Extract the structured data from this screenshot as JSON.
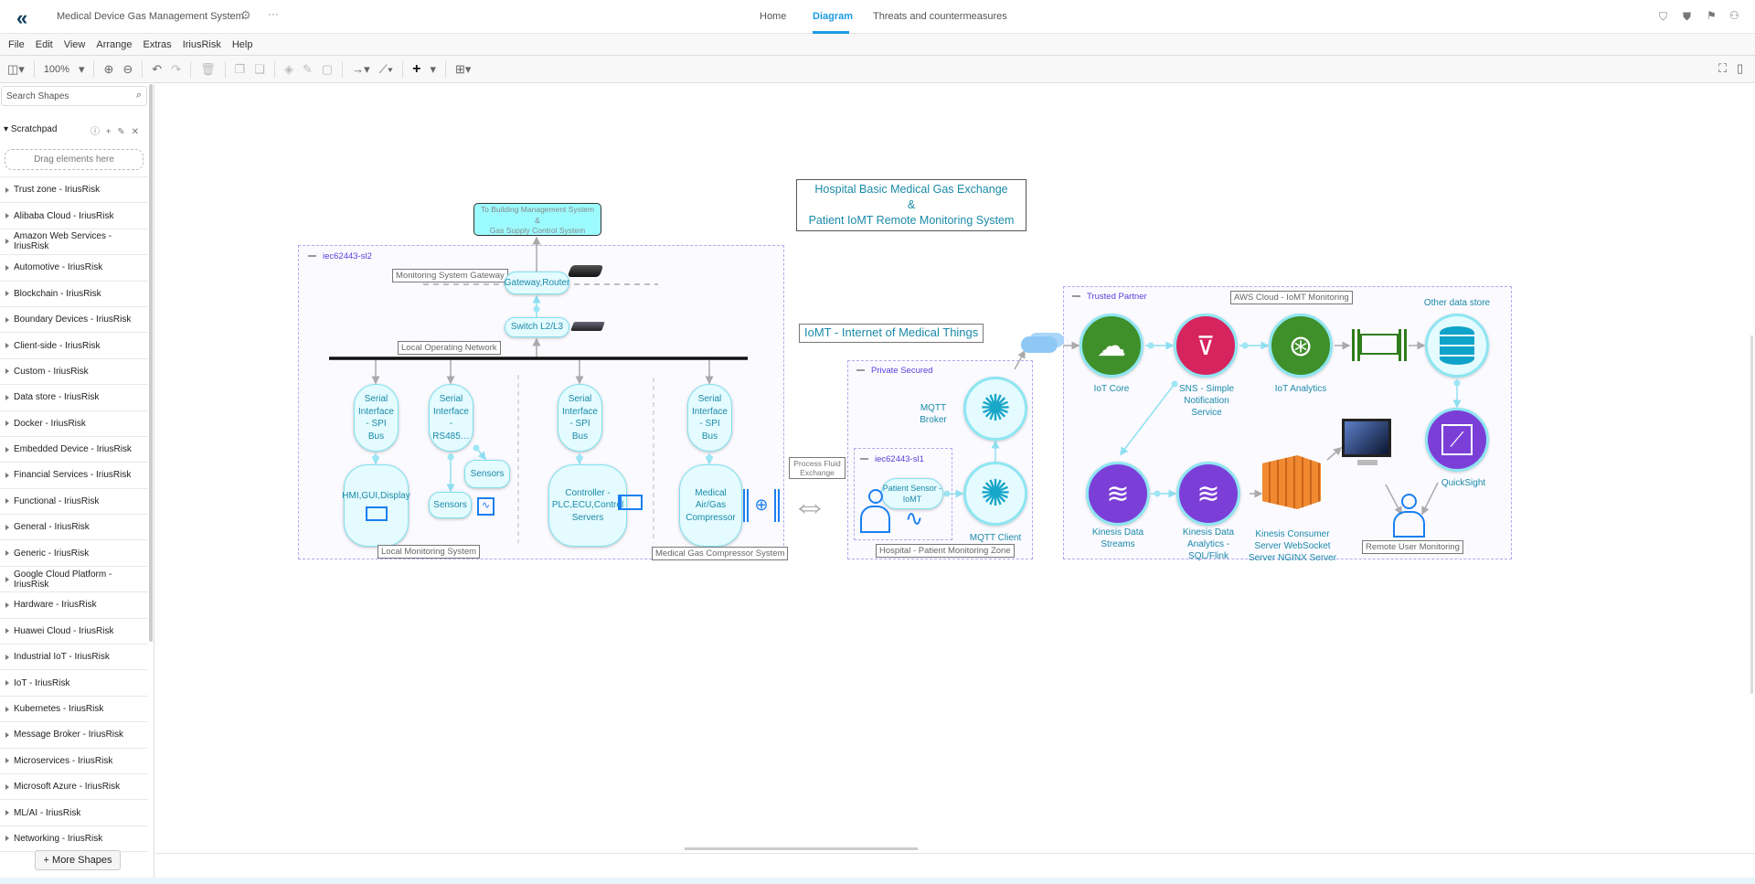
{
  "header": {
    "title": "Medical Device Gas Management System",
    "tabs": [
      "Home",
      "Diagram",
      "Threats and countermeasures"
    ],
    "active_tab": "Diagram",
    "accent": "#1a9be6"
  },
  "menu": [
    "File",
    "Edit",
    "View",
    "Arrange",
    "Extras",
    "IriusRisk",
    "Help"
  ],
  "toolbar": {
    "zoom": "100%"
  },
  "sidebar": {
    "search_placeholder": "Search Shapes",
    "scratchpad": "Scratchpad",
    "drag_hint": "Drag elements here",
    "categories": [
      "Trust zone - IriusRisk",
      "Alibaba Cloud - IriusRisk",
      "Amazon Web Services - IriusRisk",
      "Automotive - IriusRisk",
      "Blockchain - IriusRisk",
      "Boundary Devices - IriusRisk",
      "Client-side - IriusRisk",
      "Custom - IriusRisk",
      "Data store - IriusRisk",
      "Docker - IriusRisk",
      "Embedded Device - IriusRisk",
      "Financial Services - IriusRisk",
      "Functional - IriusRisk",
      "General - IriusRisk",
      "Generic - IriusRisk",
      "Google Cloud Platform - IriusRisk",
      "Hardware - IriusRisk",
      "Huawei Cloud - IriusRisk",
      "Industrial IoT - IriusRisk",
      "IoT - IriusRisk",
      "Kubernetes - IriusRisk",
      "Message Broker - IriusRisk",
      "Microservices - IriusRisk",
      "Microsoft Azure - IriusRisk",
      "ML/AI - IriusRisk",
      "Networking - IriusRisk"
    ],
    "more_shapes": "+ More Shapes"
  },
  "diagram": {
    "title1": "Hospital Basic Medical Gas Exchange",
    "title_amp": "&",
    "title2": "Patient IoMT Remote Monitoring System",
    "building1": "To Building Management System",
    "building_amp": "&",
    "building2": "Gas Supply Control System",
    "zone_sl2": "iec62443-sl2",
    "gateway_label": "Monitoring System Gateway",
    "gateway": "Gateway,Router",
    "switch": "Switch L2/L3",
    "lon": "Local Operating Network",
    "serial_spi": "Serial Interface - SPI Bus",
    "serial_rs485": "Serial Interface - RS485…",
    "hmi": "HMI,GUI,Display",
    "sensors": "Sensors",
    "controller": "Controller - PLC,ECU,Control Servers",
    "compressor": "Medical Air/Gas Compressor",
    "local_monitoring": "Local Monitoring System",
    "compressor_system": "Medical Gas Compressor System",
    "iomt": "IoMT - Internet of Medical Things",
    "process_fluid": "Process Fluid Exchange",
    "zone_private": "Private Secured",
    "zone_sl1": "iec62443-sl1",
    "patient_sensor": "Patient Sensor - IoMT",
    "mqtt_broker": "MQTT Broker",
    "mqtt_client": "MQTT Client",
    "hospital_zone": "Hospital - Patient Monitoring Zone",
    "zone_trusted": "Trusted Partner",
    "aws": "AWS Cloud - IoMT Monitoring",
    "iot_core": "IoT Core",
    "sns": "SNS - Simple Notification Service",
    "iot_analytics": "IoT Analytics",
    "other_store": "Other data store",
    "quicksight": "QuickSight",
    "kinesis_streams": "Kinesis Data Streams",
    "kinesis_analytics": "Kinesis Data Analytics - SQL/Flink",
    "consumer": "Kinesis Consumer Server WebSocket Server NGINX Server",
    "remote_user": "Remote User Monitoring",
    "colors": {
      "node_fill": "#e4fbff",
      "node_border": "#7fe3f0",
      "green": "#3f8f2a",
      "pink": "#d6245e",
      "purple": "#7b3fd8",
      "orange": "#f0892f",
      "zone": "#b5a8ec"
    }
  }
}
